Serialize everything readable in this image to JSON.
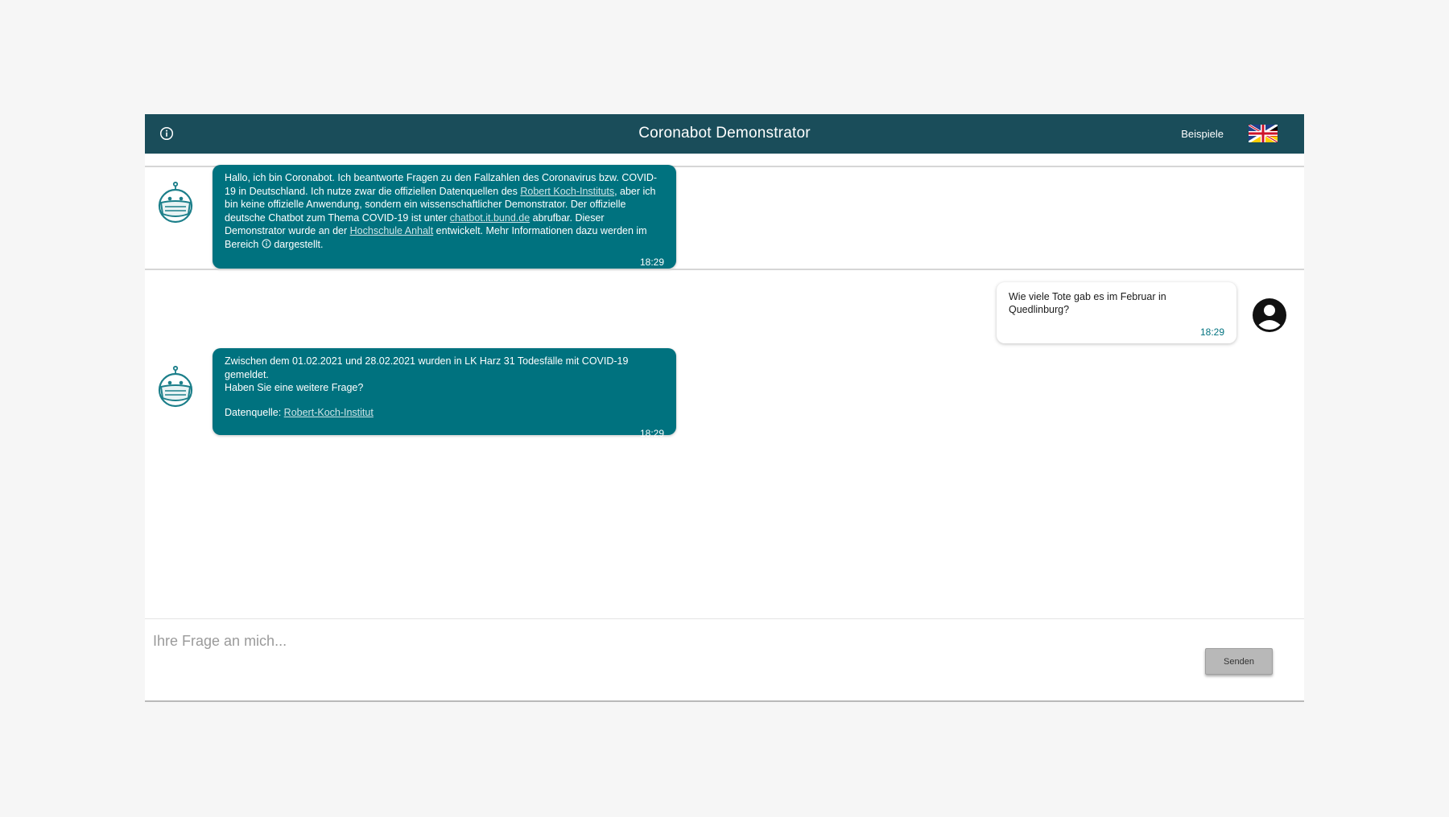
{
  "header": {
    "title": "Coronabot Demonstrator",
    "examples_label": "Beispiele",
    "info_icon": "info-circle-icon",
    "language_icon": "uk-germany-flag-icon",
    "background_color": "#1a4d5a"
  },
  "messages": [
    {
      "sender": "bot",
      "parts": {
        "p1": "Hallo, ich bin Coronabot. Ich beantworte Fragen zu den Fallzahlen des Coronavirus bzw. COVID-19 in Deutschland. Ich nutze zwar die offiziellen Datenquellen des ",
        "link1": "Robert Koch-Instituts",
        "p2": ", aber ich bin keine offizielle Anwendung, sondern ein wissenschaftlicher Demonstrator. Der offizielle deutsche Chatbot zum Thema COVID-19 ist unter ",
        "link2": "chatbot.it.bund.de",
        "p3": " abrufbar. Dieser Demonstrator wurde an der ",
        "link3": "Hochschule Anhalt",
        "p4": " entwickelt. Mehr Informationen dazu werden im Bereich ",
        "p5": " dargestellt."
      },
      "time": "18:29"
    },
    {
      "sender": "user",
      "text": "Wie viele Tote gab es im Februar in Quedlinburg?",
      "time": "18:29"
    },
    {
      "sender": "bot",
      "parts": {
        "line1": "Zwischen dem 01.02.2021 und 28.02.2021 wurden in LK Harz 31 Todesfälle mit COVID-19 gemeldet.",
        "line2": "Haben Sie eine weitere Frage?",
        "source_label": "Datenquelle: ",
        "source_link": "Robert-Koch-Institut"
      },
      "time": "18:29"
    }
  ],
  "input": {
    "placeholder": "Ihre Frage an mich...",
    "value": ""
  },
  "send_button": {
    "label": "Senden"
  },
  "colors": {
    "bot_bubble": "#00727f",
    "accent": "#00727f",
    "page_background": "#f6f6f6"
  }
}
